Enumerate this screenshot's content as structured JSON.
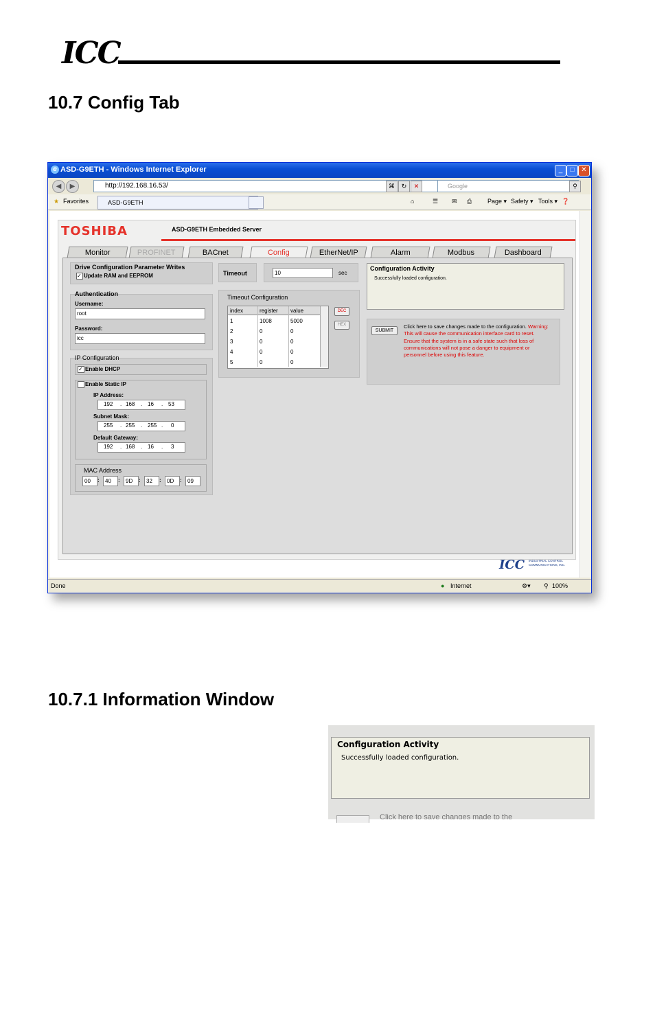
{
  "header": {
    "logo_text": "ICC"
  },
  "section": {
    "title": "10.7  Config Tab"
  },
  "subsection": {
    "title": "10.7.1  Information Window"
  },
  "browser": {
    "window_title": "ASD-G9ETH - Windows Internet Explorer",
    "address": "http://192.168.16.53/",
    "search_placeholder": "Google",
    "favorites_label": "Favorites",
    "tab_label": "ASD-G9ETH",
    "toolbar": {
      "page": "Page ▾",
      "safety": "Safety ▾",
      "tools": "Tools ▾"
    },
    "status_left": "Done",
    "status_zone": "Internet",
    "zoom": "100%"
  },
  "app": {
    "brand": "TOSHIBA",
    "server_title": "ASD-G9ETH Embedded Server",
    "tabs": [
      "Monitor",
      "PROFINET",
      "BACnet",
      "Config",
      "EtherNet/IP",
      "Alarm",
      "Modbus",
      "Dashboard"
    ],
    "drive_config": {
      "title": "Drive Configuration Parameter Writes",
      "checkbox_label": "Update RAM and EEPROM"
    },
    "timeout": {
      "label": "Timeout",
      "value": "10",
      "unit": "sec"
    },
    "auth": {
      "title": "Authentication",
      "username_label": "Username:",
      "username": "root",
      "password_label": "Password:",
      "password": "icc"
    },
    "ip": {
      "title": "IP Configuration",
      "dhcp_label": "Enable DHCP",
      "static_label": "Enable Static IP",
      "ip_label": "IP Address:",
      "ip": [
        "192",
        "168",
        "16",
        "53"
      ],
      "mask_label": "Subnet Mask:",
      "mask": [
        "255",
        "255",
        "255",
        "0"
      ],
      "gw_label": "Default Gateway:",
      "gw": [
        "192",
        "168",
        "16",
        "3"
      ]
    },
    "mac": {
      "title": "MAC Address",
      "octets": [
        "00",
        "40",
        "9D",
        "32",
        "0D",
        "09"
      ]
    },
    "timeout_config": {
      "title": "Timeout Configuration",
      "columns": [
        "index",
        "register",
        "value"
      ],
      "rows": [
        [
          "1",
          "1008",
          "5000"
        ],
        [
          "2",
          "0",
          "0"
        ],
        [
          "3",
          "0",
          "0"
        ],
        [
          "4",
          "0",
          "0"
        ],
        [
          "5",
          "0",
          "0"
        ]
      ],
      "dec_label": "DEC",
      "hex_label": "HEX"
    },
    "activity": {
      "title": "Configuration Activity",
      "message": "Successfully loaded configuration."
    },
    "submit": {
      "button": "SUBMIT",
      "text": "Click here to save changes made to the configuration.",
      "warning": "Warning: This will cause the communication interface card to reset. Ensure that the system is in a safe state such that loss of communications will not pose a danger to equipment or personnel before using this feature."
    },
    "footer_logo": "ICC",
    "footer_company": "INDUSTRIAL CONTROL COMMUNICATIONS, INC."
  },
  "zoom_panel": {
    "title": "Configuration Activity",
    "message": "Successfully loaded configuration.",
    "truncated_text": "Click here to save changes made to the"
  }
}
